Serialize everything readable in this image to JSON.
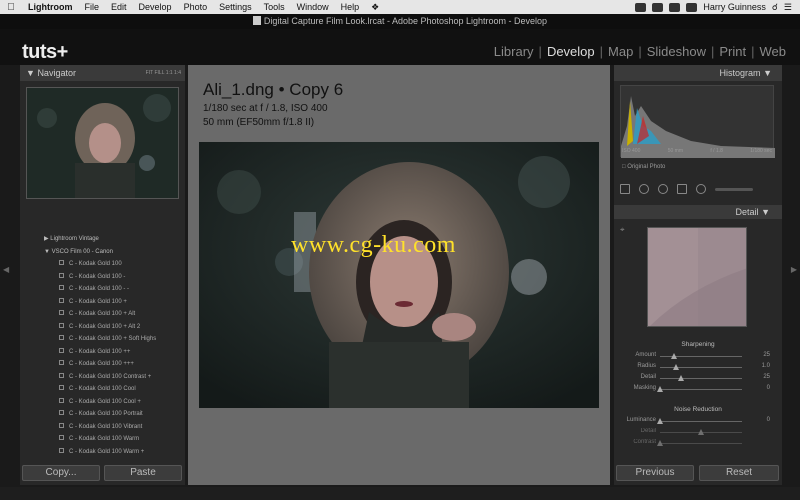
{
  "menubar": {
    "items": [
      "Lightroom",
      "File",
      "Edit",
      "Develop",
      "Photo",
      "Settings",
      "Tools",
      "Window",
      "Help"
    ],
    "user": "Harry Guinness"
  },
  "window": {
    "title": "Digital Capture Film Look.lrcat - Adobe Photoshop Lightroom - Develop"
  },
  "identity": {
    "logo": "tuts+"
  },
  "modules": [
    "Library",
    "Develop",
    "Map",
    "Slideshow",
    "Print",
    "Web"
  ],
  "modules_active": "Develop",
  "navigator": {
    "title": "Navigator",
    "zoom_fit": "FIT",
    "zoom_fill": "FILL",
    "zoom_1": "1:1",
    "zoom_4": "1:4"
  },
  "presets": {
    "folder_top": "VSCO Film 00 - Canon",
    "folder_prev": "Lightroom Vintage",
    "items": [
      "C - Kodak Gold 100",
      "C - Kodak Gold 100 -",
      "C - Kodak Gold 100 - -",
      "C - Kodak Gold 100 +",
      "C - Kodak Gold 100 + Alt",
      "C - Kodak Gold 100 + Alt 2",
      "C - Kodak Gold 100 + Soft Highs",
      "C - Kodak Gold 100 ++",
      "C - Kodak Gold 100 +++",
      "C - Kodak Gold 100 Contrast +",
      "C - Kodak Gold 100 Cool",
      "C - Kodak Gold 100 Cool +",
      "C - Kodak Gold 100 Portrait",
      "C - Kodak Gold 100 Vibrant",
      "C - Kodak Gold 100 Warm",
      "C - Kodak Gold 100 Warm +"
    ]
  },
  "buttons": {
    "copy": "Copy...",
    "paste": "Paste",
    "previous": "Previous",
    "reset": "Reset"
  },
  "photo_info": {
    "line1": "Ali_1.dng  •  Copy 6",
    "line2": "1/180 sec at f / 1.8, ISO 400",
    "line3": "50 mm (EF50mm f/1.8 II)"
  },
  "watermark": "www.cg-ku.com",
  "histogram": {
    "title": "Histogram",
    "iso": "ISO 400",
    "focal": "50 mm",
    "aperture": "f / 1.8",
    "shutter": "1/180 sec",
    "original": "Original Photo"
  },
  "detail": {
    "title": "Detail",
    "sharpening": {
      "title": "Sharpening",
      "rows": [
        {
          "label": "Amount",
          "value": "25",
          "pos": 0.17
        },
        {
          "label": "Radius",
          "value": "1.0",
          "pos": 0.2
        },
        {
          "label": "Detail",
          "value": "25",
          "pos": 0.25
        },
        {
          "label": "Masking",
          "value": "0",
          "pos": 0.0
        }
      ]
    },
    "noise": {
      "title": "Noise Reduction",
      "rows": [
        {
          "label": "Luminance",
          "value": "0",
          "pos": 0.0
        },
        {
          "label": "Detail",
          "value": "",
          "pos": 0.5
        },
        {
          "label": "Contrast",
          "value": "",
          "pos": 0.0
        }
      ]
    }
  },
  "colors": {
    "panel": "#282828",
    "header": "#3a3a3a",
    "center_bg": "#6a6a6a",
    "watermark": "#ffe12a"
  }
}
